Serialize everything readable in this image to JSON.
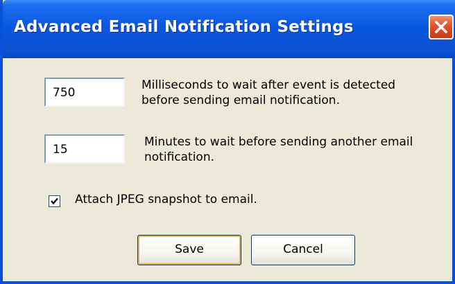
{
  "window": {
    "title": "Advanced Email Notification Settings"
  },
  "fields": [
    {
      "value": "750",
      "description_line1": "Milliseconds to wait after event is detected",
      "description_line2": "before sending email notification."
    },
    {
      "value": "15",
      "description_line1": "Minutes to wait before sending another email",
      "description_line2": "notification."
    }
  ],
  "attach_snapshot": {
    "checked": true,
    "label": "Attach JPEG snapshot to email."
  },
  "buttons": {
    "save_label": "Save",
    "cancel_label": "Cancel"
  },
  "colors": {
    "titlebar": "#0a54d8",
    "dialog_background": "#ECE9D8",
    "close_button": "#e2512a"
  },
  "icons": {
    "close": "close-icon",
    "check": "checkmark-icon"
  }
}
